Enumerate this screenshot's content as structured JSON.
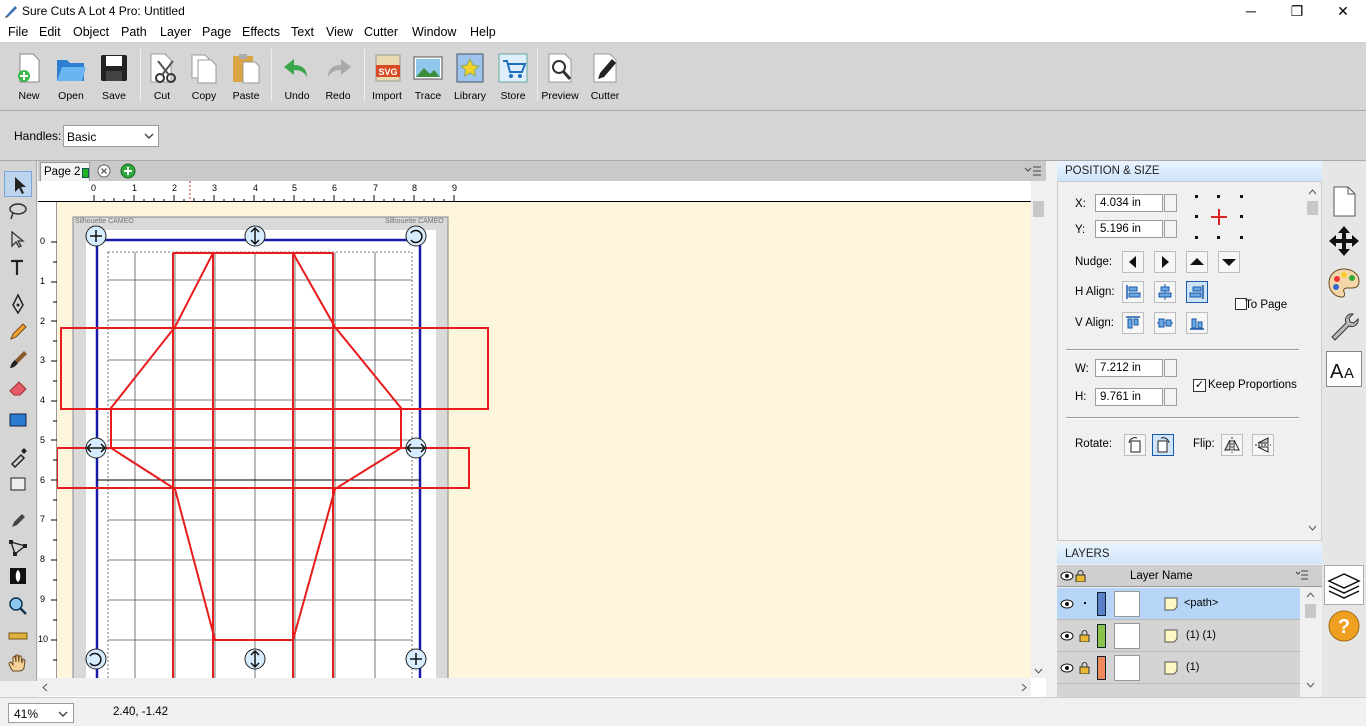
{
  "window": {
    "title": "Sure Cuts A Lot 4 Pro: Untitled",
    "minimize": "─",
    "maximize": "❐",
    "close": "✕"
  },
  "menu": [
    "File",
    "Edit",
    "Object",
    "Path",
    "Layer",
    "Page",
    "Effects",
    "Text",
    "View",
    "Cutter",
    "Window",
    "Help"
  ],
  "toolbar": [
    {
      "label": "New",
      "icon": "new-document-icon"
    },
    {
      "label": "Open",
      "icon": "open-folder-icon"
    },
    {
      "label": "Save",
      "icon": "floppy-disk-icon"
    },
    {
      "label": "Cut",
      "icon": "scissors-icon"
    },
    {
      "label": "Copy",
      "icon": "copy-icon"
    },
    {
      "label": "Paste",
      "icon": "paste-clipboard-icon"
    },
    {
      "label": "Undo",
      "icon": "undo-arrow-icon"
    },
    {
      "label": "Redo",
      "icon": "redo-arrow-icon"
    },
    {
      "label": "Import",
      "icon": "svg-import-icon"
    },
    {
      "label": "Trace",
      "icon": "trace-image-icon"
    },
    {
      "label": "Library",
      "icon": "star-library-icon"
    },
    {
      "label": "Store",
      "icon": "shopping-cart-icon"
    },
    {
      "label": "Preview",
      "icon": "magnifier-preview-icon"
    },
    {
      "label": "Cutter",
      "icon": "cutter-pen-icon"
    }
  ],
  "options": {
    "handles_label": "Handles:",
    "handles_value": "Basic"
  },
  "page_tab": {
    "label": "Page 2"
  },
  "ruler": {
    "top": [
      "0",
      "1",
      "2",
      "3",
      "4",
      "5",
      "6",
      "7",
      "8",
      "9"
    ],
    "left": [
      "0",
      "1",
      "2",
      "3",
      "4",
      "5",
      "6",
      "7",
      "8",
      "9",
      "10"
    ]
  },
  "mat": {
    "brand_left": "Silhouette CAMEO",
    "brand_right": "Silhouette CAMEO"
  },
  "position_size": {
    "header": "POSITION & SIZE",
    "x_label": "X:",
    "x_value": "4.034 in",
    "y_label": "Y:",
    "y_value": "5.196 in",
    "nudge_label": "Nudge:",
    "halign_label": "H Align:",
    "valign_label": "V Align:",
    "to_page_label": "To Page",
    "to_page_checked": false,
    "w_label": "W:",
    "w_value": "7.212 in",
    "h_label": "H:",
    "h_value": "9.761 in",
    "keep_proportions_label": "Keep Proportions",
    "keep_proportions_checked": true,
    "rotate_label": "Rotate:",
    "flip_label": "Flip:"
  },
  "layers": {
    "header": "LAYERS",
    "column_name": "Layer Name",
    "rows": [
      {
        "name": "<path>",
        "color": "#5b7fc7",
        "selected": true
      },
      {
        "name": "(1) (1)",
        "color": "#8bc34a",
        "selected": false
      },
      {
        "name": "(1)",
        "color": "#f08a5d",
        "selected": false
      }
    ]
  },
  "status": {
    "zoom": "41%",
    "coords": "2.40, -1.42"
  },
  "colors": {
    "accent": "#cfe4fa",
    "cut_line": "#e81c1c",
    "mat_border": "#1a1aa8"
  }
}
